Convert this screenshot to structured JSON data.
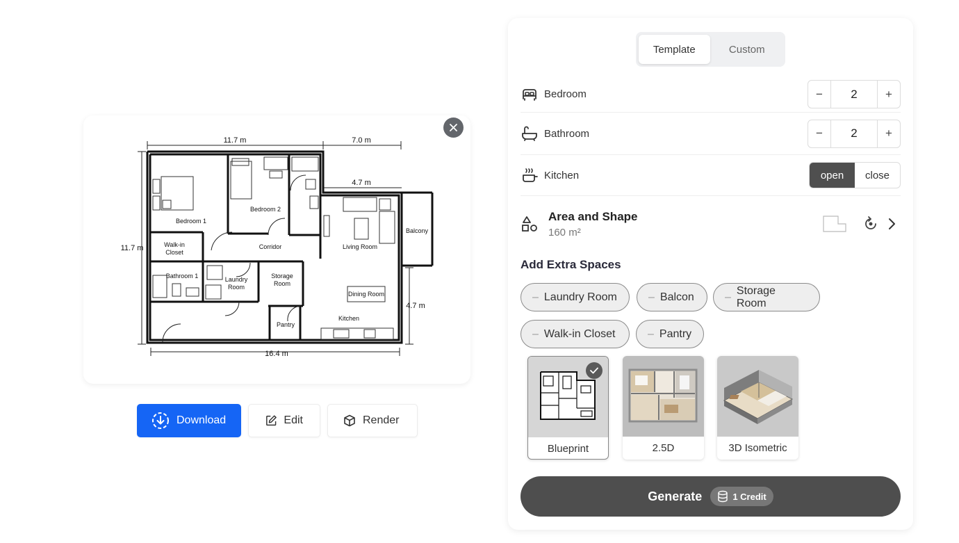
{
  "tabs": [
    {
      "label": "Template",
      "active": true
    },
    {
      "label": "Custom",
      "active": false
    }
  ],
  "bedroom": {
    "label": "Bedroom",
    "value": "2",
    "minus": "−",
    "plus": "+"
  },
  "bathroom": {
    "label": "Bathroom",
    "value": "2",
    "minus": "−",
    "plus": "+"
  },
  "kitchen": {
    "label": "Kitchen",
    "options": [
      "open",
      "close"
    ],
    "selected": "open"
  },
  "area": {
    "title": "Area and Shape",
    "value": "160 m²"
  },
  "extra_spaces": {
    "title": "Add Extra Spaces",
    "items": [
      "Laundry Room",
      "Balcon",
      "Storage Room",
      "Walk-in Closet",
      "Pantry"
    ]
  },
  "styles": [
    {
      "label": "Blueprint",
      "selected": true
    },
    {
      "label": "2.5D",
      "selected": false
    },
    {
      "label": "3D Isometric",
      "selected": false
    }
  ],
  "generate": {
    "label": "Generate",
    "credit": "1 Credit"
  },
  "actions": {
    "download": "Download",
    "edit": "Edit",
    "render": "Render"
  },
  "plan": {
    "dims": {
      "top_left": "11.7 m",
      "top_right": "7.0 m",
      "inner_top": "4.7 m",
      "left": "11.7 m",
      "right": "4.7 m",
      "bottom": "16.4 m"
    },
    "rooms": {
      "bedroom1": "Bedroom 1",
      "bedroom2": "Bedroom 2",
      "walkin1": "Walk-in",
      "walkin2": "Closet",
      "corridor": "Corridor",
      "living": "Living Room",
      "balcony": "Balcony",
      "bathroom1": "Bathroom 1",
      "laundry1": "Laundry",
      "laundry2": "Room",
      "storage1": "Storage",
      "storage2": "Room",
      "dining": "Dining Room",
      "kitchen": "Kitchen",
      "pantry": "Pantry"
    }
  },
  "colors": {
    "accent": "#1565f5",
    "dark": "#4e4e4e"
  }
}
